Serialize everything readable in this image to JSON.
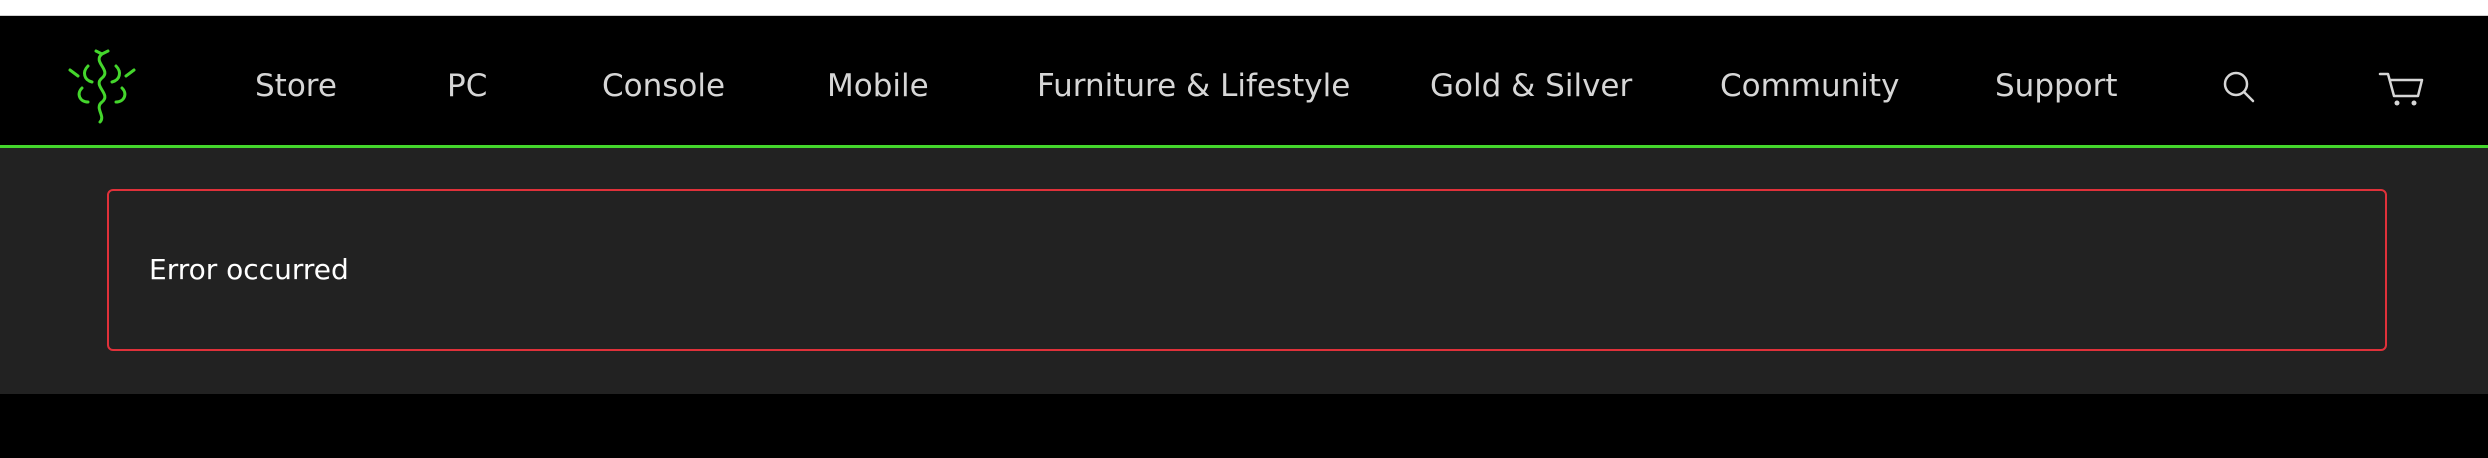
{
  "nav": {
    "brand_icon": "razer-snake-logo",
    "items": [
      {
        "label": "Store"
      },
      {
        "label": "PC"
      },
      {
        "label": "Console"
      },
      {
        "label": "Mobile"
      },
      {
        "label": "Furniture & Lifestyle"
      },
      {
        "label": "Gold & Silver"
      },
      {
        "label": "Community"
      },
      {
        "label": "Support"
      }
    ],
    "search_icon": "search-icon",
    "cart_icon": "cart-icon",
    "accent_color": "#44d62c"
  },
  "main": {
    "error_message": "Error occurred",
    "error_border_color": "#e0313a"
  }
}
